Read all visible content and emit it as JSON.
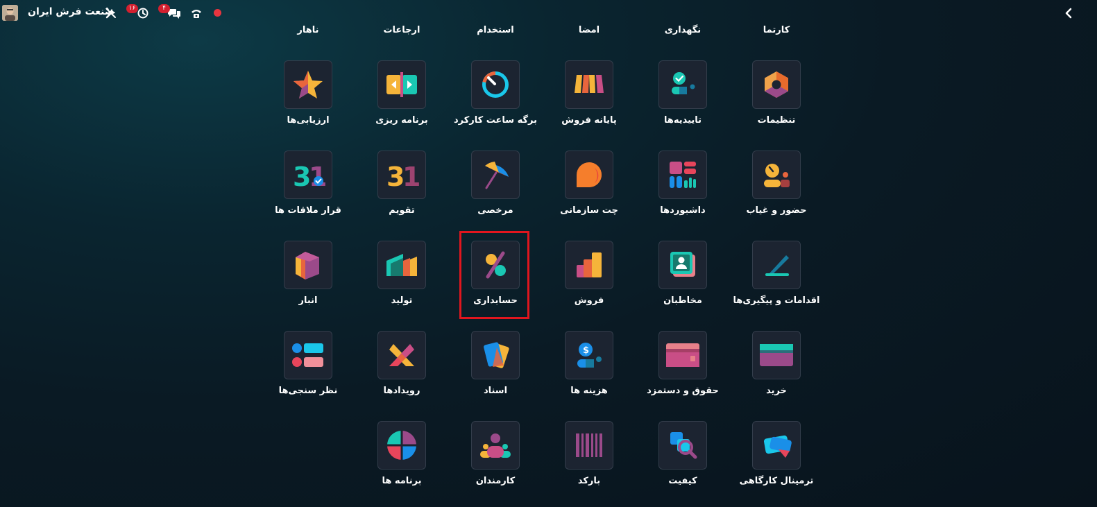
{
  "topbar": {
    "company": "صنعت فرش ایران",
    "activity_badge": "۱۶",
    "messages_badge": "۴",
    "icons": [
      "avatar",
      "tools-icon",
      "activity-clock-icon",
      "chat-icon",
      "phone-icon",
      "recording-dot-icon",
      "back-chevron-icon"
    ],
    "accent_badge_color": "#d3202f"
  },
  "top_row_labels": [
    "کارتما",
    "نگهداری",
    "امضا",
    "استخدام",
    "ارجاعات",
    "ناهار"
  ],
  "apps": [
    {
      "label": "تنظیمات",
      "icon": "settings-icon"
    },
    {
      "label": "تاییدیه‌ها",
      "icon": "approvals-icon"
    },
    {
      "label": "پایانه فروش",
      "icon": "point-of-sale-icon"
    },
    {
      "label": "برگه ساعت کارکرد",
      "icon": "timesheets-icon"
    },
    {
      "label": "برنامه ریزی",
      "icon": "planning-icon"
    },
    {
      "label": "ارزیابی‌ها",
      "icon": "appraisals-icon"
    },
    {
      "label": "حضور و غیاب",
      "icon": "attendances-icon"
    },
    {
      "label": "داشبوردها",
      "icon": "dashboards-icon"
    },
    {
      "label": "چت سازمانی",
      "icon": "discuss-icon"
    },
    {
      "label": "مرخصی",
      "icon": "time-off-icon"
    },
    {
      "label": "تقویم",
      "icon": "calendar-icon",
      "number": "31"
    },
    {
      "label": "قرار ملاقات ها",
      "icon": "appointments-icon",
      "number": "31"
    },
    {
      "label": "اقدامات و پیگیری‌ها",
      "icon": "to-do-icon"
    },
    {
      "label": "مخاطبان",
      "icon": "contacts-icon"
    },
    {
      "label": "فروش",
      "icon": "sales-icon"
    },
    {
      "label": "حسابداری",
      "icon": "accounting-icon",
      "highlighted": true
    },
    {
      "label": "تولید",
      "icon": "manufacturing-icon"
    },
    {
      "label": "انبار",
      "icon": "inventory-icon"
    },
    {
      "label": "خرید",
      "icon": "purchase-icon"
    },
    {
      "label": "حقوق و دستمزد",
      "icon": "payroll-icon"
    },
    {
      "label": "هزینه ها",
      "icon": "expenses-icon"
    },
    {
      "label": "اسناد",
      "icon": "documents-icon"
    },
    {
      "label": "رویدادها",
      "icon": "events-icon"
    },
    {
      "label": "نظر سنجی‌ها",
      "icon": "surveys-icon"
    },
    {
      "label": "ترمینال کارگاهی",
      "icon": "shop-floor-icon"
    },
    {
      "label": "کیفیت",
      "icon": "quality-icon"
    },
    {
      "label": "بارکد",
      "icon": "barcode-icon"
    },
    {
      "label": "کارمندان",
      "icon": "employees-icon"
    },
    {
      "label": "برنامه ها",
      "icon": "apps-icon"
    }
  ],
  "colors": {
    "highlight": "#e0161e",
    "tile_bg": "#1c2431",
    "background": "#0a1a24"
  }
}
